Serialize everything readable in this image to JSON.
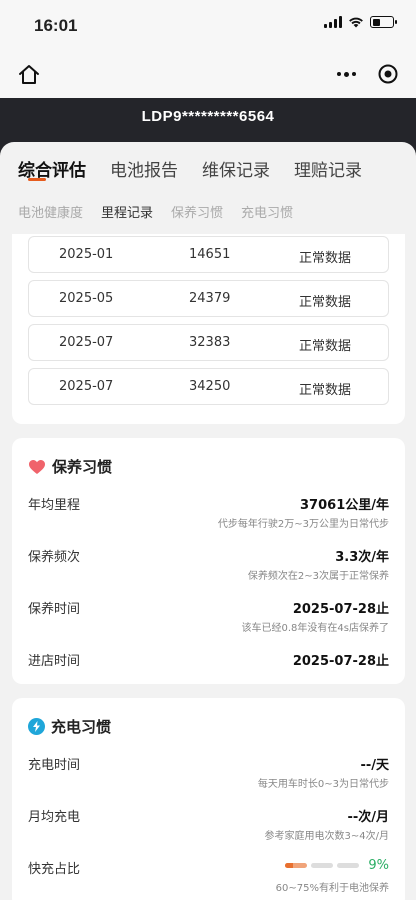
{
  "status_bar": {
    "time": "16:01"
  },
  "header": {
    "plate": "LDP9*********6564"
  },
  "main_tabs": [
    {
      "label": "综合评估",
      "active": true
    },
    {
      "label": "电池报告",
      "active": false
    },
    {
      "label": "维保记录",
      "active": false
    },
    {
      "label": "理赔记录",
      "active": false
    }
  ],
  "sub_tabs": [
    {
      "label": "电池健康度",
      "active": false
    },
    {
      "label": "里程记录",
      "active": true
    },
    {
      "label": "保养习惯",
      "active": false
    },
    {
      "label": "充电习惯",
      "active": false
    }
  ],
  "mileage_records": [
    {
      "date": "2025-01",
      "km": "14651",
      "status": "正常数据"
    },
    {
      "date": "2025-05",
      "km": "24379",
      "status": "正常数据"
    },
    {
      "date": "2025-07",
      "km": "32383",
      "status": "正常数据"
    },
    {
      "date": "2025-07",
      "km": "34250",
      "status": "正常数据"
    }
  ],
  "maintenance": {
    "title": "保养习惯",
    "rows": [
      {
        "label": "年均里程",
        "value": "37061公里/年",
        "note": "代步每年行驶2万~3万公里为日常代步"
      },
      {
        "label": "保养频次",
        "value": "3.3次/年",
        "note": "保养频次在2~3次属于正常保养"
      },
      {
        "label": "保养时间",
        "value": "2025-07-28止",
        "note": "该车已经0.8年没有在4s店保养了"
      },
      {
        "label": "进店时间",
        "value": "2025-07-28止",
        "note": ""
      }
    ]
  },
  "charging": {
    "title": "充电习惯",
    "rows": [
      {
        "label": "充电时间",
        "value": "--/天",
        "note": "每天用车时长0~3为日常代步"
      },
      {
        "label": "月均充电",
        "value": "--次/月",
        "note": "参考家庭用电次数3~4次/月"
      },
      {
        "label": "快充占比",
        "value": "9%",
        "note": "60~75%有利于电池保养"
      }
    ],
    "fast_charge_ratio": 0.09
  },
  "colors": {
    "accent": "#e65c1e",
    "green": "#2aae64",
    "header_bg": "#24252a"
  }
}
